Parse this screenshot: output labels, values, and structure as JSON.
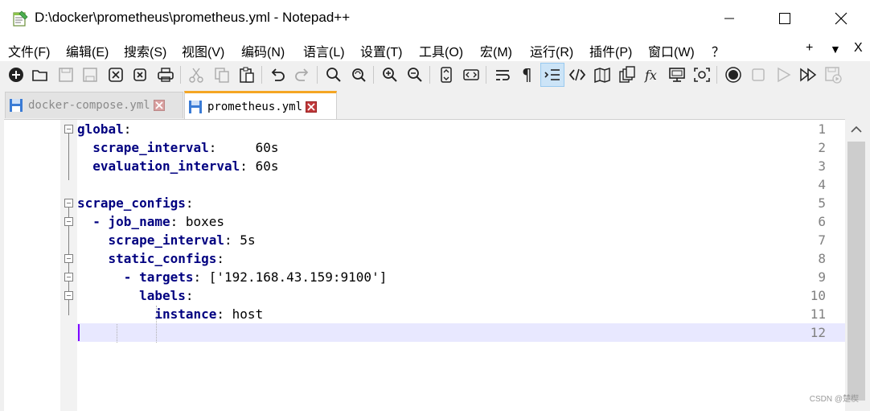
{
  "window": {
    "title": "D:\\docker\\prometheus\\prometheus.yml - Notepad++",
    "minimize_icon": "minimize-icon",
    "maximize_icon": "maximize-icon",
    "close_icon": "close-icon"
  },
  "menu": {
    "items": [
      "文件(F)",
      "编辑(E)",
      "搜索(S)",
      "视图(V)",
      "编码(N)",
      "语言(L)",
      "设置(T)",
      "工具(O)",
      "宏(M)",
      "运行(R)",
      "插件(P)",
      "窗口(W)",
      "？"
    ],
    "plus": "+",
    "dropdown": "▼",
    "close": "X"
  },
  "toolbar": {
    "icons": [
      "new-file-icon",
      "open-file-icon",
      "save-icon",
      "save-all-icon",
      "close-icon",
      "close-all-icon",
      "print-icon",
      "cut-icon",
      "copy-icon",
      "paste-icon",
      "undo-icon",
      "redo-icon",
      "find-icon",
      "replace-icon",
      "zoom-in-icon",
      "zoom-out-icon",
      "sync-vertical-icon",
      "sync-horizontal-icon",
      "word-wrap-icon",
      "show-all-chars-icon",
      "indent-guide-icon",
      "xml-icon",
      "document-map-icon",
      "project-panel-icon",
      "function-list-icon",
      "monitor-icon",
      "screenshot-icon",
      "record-macro-icon",
      "stop-macro-icon",
      "play-macro-icon",
      "run-macro-multiple-icon",
      "save-macro-icon"
    ],
    "active_icon": "indent-guide-icon"
  },
  "tabs": [
    {
      "label": "docker-compose.yml",
      "active": false
    },
    {
      "label": "prometheus.yml",
      "active": true
    }
  ],
  "editor": {
    "current_line": 12,
    "lines": [
      {
        "num": "1",
        "key": "global",
        "sep": ":",
        "value": ""
      },
      {
        "num": "2",
        "key": "  scrape_interval",
        "sep": ":",
        "value": "     60s"
      },
      {
        "num": "3",
        "key": "  evaluation_interval",
        "sep": ":",
        "value": " 60s"
      },
      {
        "num": "4",
        "key": "",
        "sep": "",
        "value": ""
      },
      {
        "num": "5",
        "key": "scrape_configs",
        "sep": ":",
        "value": ""
      },
      {
        "num": "6",
        "key": "  - job_name",
        "sep": ":",
        "value": " boxes"
      },
      {
        "num": "7",
        "key": "    scrape_interval",
        "sep": ":",
        "value": " 5s"
      },
      {
        "num": "8",
        "key": "    static_configs",
        "sep": ":",
        "value": ""
      },
      {
        "num": "9",
        "key": "      - targets",
        "sep": ":",
        "value": " ['192.168.43.159:9100']"
      },
      {
        "num": "10",
        "key": "        labels",
        "sep": ":",
        "value": ""
      },
      {
        "num": "11",
        "key": "          instance",
        "sep": ":",
        "value": " host"
      },
      {
        "num": "12",
        "key": "",
        "sep": "",
        "value": ""
      }
    ]
  },
  "watermark": "CSDN @楚楔"
}
